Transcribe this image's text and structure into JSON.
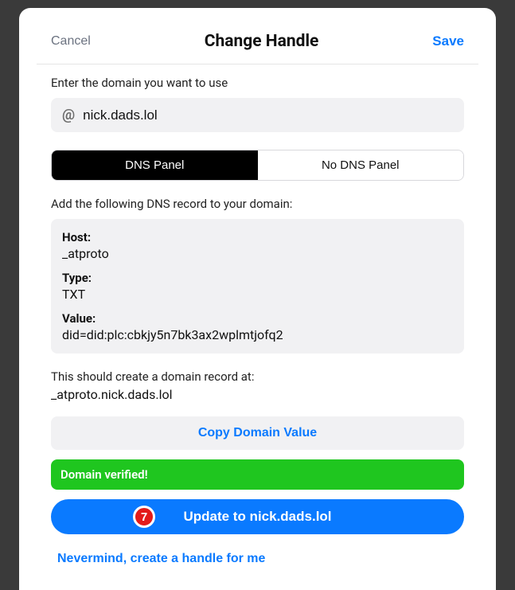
{
  "header": {
    "cancel": "Cancel",
    "title": "Change Handle",
    "save": "Save"
  },
  "domain": {
    "prompt": "Enter the domain you want to use",
    "at_symbol": "@",
    "value": "nick.dads.lol"
  },
  "tabs": {
    "dns": "DNS Panel",
    "no_dns": "No DNS Panel"
  },
  "dns": {
    "instruction": "Add the following DNS record to your domain:",
    "host_label": "Host:",
    "host_value": "_atproto",
    "type_label": "Type:",
    "type_value": "TXT",
    "value_label": "Value:",
    "value_value": "did=did:plc:cbkjy5n7bk3ax2wplmtjofq2"
  },
  "record": {
    "note": "This should create a domain record at:",
    "value": "_atproto.nick.dads.lol"
  },
  "actions": {
    "copy": "Copy Domain Value",
    "verified": "Domain verified!",
    "update": "Update to nick.dads.lol",
    "step": "7",
    "nevermind": "Nevermind, create a handle for me"
  }
}
